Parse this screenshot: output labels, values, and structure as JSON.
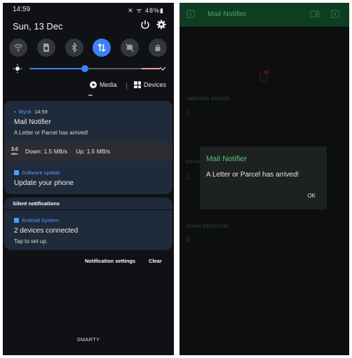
{
  "left": {
    "status": {
      "time": "14:59",
      "icons_text": "✕ ᯤ ||| 48%▮",
      "battery": "48%"
    },
    "date": "Sun, 13 Dec",
    "quick_settings": [
      {
        "icon": "wifi-icon",
        "active": false
      },
      {
        "icon": "sim-icon",
        "active": false
      },
      {
        "icon": "bluetooth-icon",
        "active": false
      },
      {
        "icon": "mobile-data-icon",
        "active": true
      },
      {
        "icon": "sound-off-icon",
        "active": false
      },
      {
        "icon": "lock-rotation-icon",
        "active": false
      }
    ],
    "brightness_level": 0.45,
    "media_label": "Media",
    "devices_label": "Devices",
    "blynk_notification": {
      "app": "Blynk",
      "time": "14:59",
      "title": "Mail Notifier",
      "message": "A Letter or Parcel has arrived!"
    },
    "network_speed": {
      "icon_top": "3.0",
      "icon_bottom": "MB/s",
      "down": "Down: 1.5 MB/s",
      "up": "Up: 1.5 MB/s"
    },
    "software_update": {
      "app": "Software update",
      "title": "Update your phone"
    },
    "silent_label": "Silent notifications",
    "android_system": {
      "app": "Android System",
      "title": "2 devices connected",
      "message": "Tap to set up."
    },
    "notification_settings": "Notification settings",
    "clear": "Clear",
    "carrier": "SMARTY",
    "accent_color": "#3b82f6"
  },
  "right": {
    "app_title": "Mail Notifier",
    "widgets": [
      {
        "label": "VIBRATION SENSOR",
        "value": "1"
      },
      {
        "label": "DISTANCE",
        "value": "1"
      },
      {
        "label": "SOUND DETECTION",
        "value": "0"
      }
    ],
    "dialog": {
      "title": "Mail Notifier",
      "message": "A Letter or Parcel has arrived!",
      "ok": "OK"
    },
    "header_color": "#0f3d22",
    "accent_color": "#58c27b"
  }
}
